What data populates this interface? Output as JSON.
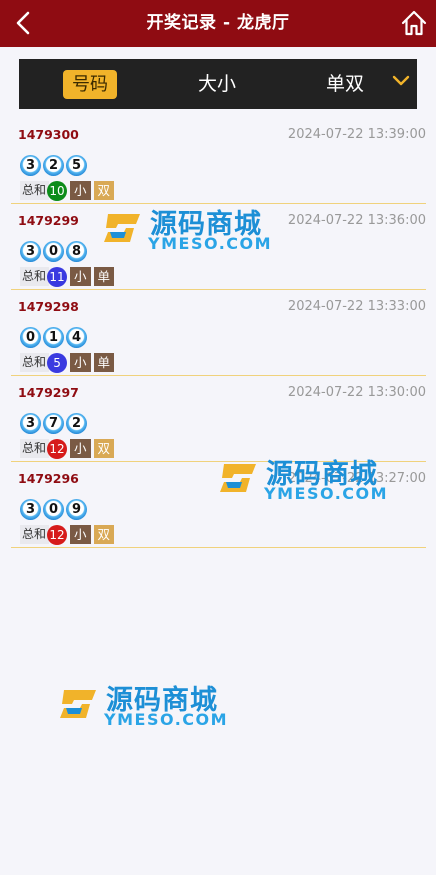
{
  "header": {
    "title": "开奖记录 - 龙虎厅",
    "back_icon": "chevron-left-icon",
    "home_icon": "home-icon",
    "background": "#8f0c12"
  },
  "tabs": [
    {
      "label": "号码",
      "active": true
    },
    {
      "label": "大小",
      "active": false
    },
    {
      "label": "单双",
      "active": false
    }
  ],
  "tab_toggle_icon": "chevron-down-icon",
  "colors": {
    "accent": "#f1b32a",
    "issue_text": "#8f0c12",
    "tag_small": "#7a5a44",
    "tag_even": "#d9a955",
    "tag_odd": "#7a5a44",
    "sum_green": "#0c8c1a",
    "sum_blue": "#3a3ae0",
    "sum_red": "#d61b1b"
  },
  "records": [
    {
      "issue": "1479300",
      "time": "2024-07-22 13:39:00",
      "balls": [
        "3",
        "2",
        "5"
      ],
      "sum_label": "总和",
      "sum": "10",
      "sum_color": "#0c8c1a",
      "size": "小",
      "parity": "双",
      "parity_color": "#d9a955"
    },
    {
      "issue": "1479299",
      "time": "2024-07-22 13:36:00",
      "balls": [
        "3",
        "0",
        "8"
      ],
      "sum_label": "总和",
      "sum": "11",
      "sum_color": "#3a3ae0",
      "size": "小",
      "parity": "单",
      "parity_color": "#7a5a44"
    },
    {
      "issue": "1479298",
      "time": "2024-07-22 13:33:00",
      "balls": [
        "0",
        "1",
        "4"
      ],
      "sum_label": "总和",
      "sum": "5",
      "sum_color": "#3a3ae0",
      "size": "小",
      "parity": "单",
      "parity_color": "#7a5a44"
    },
    {
      "issue": "1479297",
      "time": "2024-07-22 13:30:00",
      "balls": [
        "3",
        "7",
        "2"
      ],
      "sum_label": "总和",
      "sum": "12",
      "sum_color": "#d61b1b",
      "size": "小",
      "parity": "双",
      "parity_color": "#d9a955"
    },
    {
      "issue": "1479296",
      "time": "2024-07-22 13:27:00",
      "balls": [
        "3",
        "0",
        "9"
      ],
      "sum_label": "总和",
      "sum": "12",
      "sum_color": "#d61b1b",
      "size": "小",
      "parity": "双",
      "parity_color": "#d9a955"
    }
  ],
  "watermark": {
    "cn": "源码商城",
    "en": "YMESO.COM"
  }
}
